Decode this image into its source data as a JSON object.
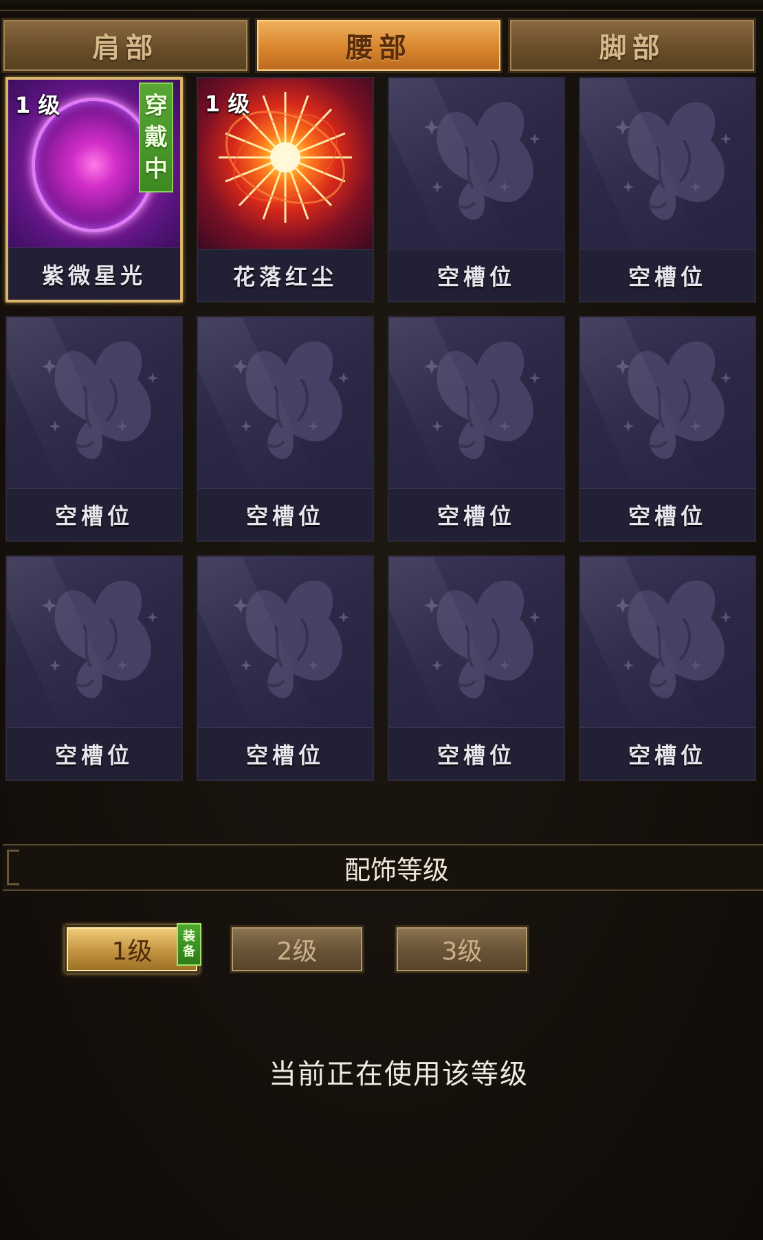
{
  "tabs": [
    {
      "label": "肩部",
      "active": false
    },
    {
      "label": "腰部",
      "active": true
    },
    {
      "label": "脚部",
      "active": false
    }
  ],
  "slots": [
    {
      "name": "紫微星光",
      "level": "1 级",
      "equipped_tag": [
        "穿",
        "戴",
        "中"
      ],
      "art": "purple-orb-icon",
      "selected": true
    },
    {
      "name": "花落红尘",
      "level": "1 级",
      "art": "red-starburst-icon"
    },
    {
      "name": "空槽位",
      "art": "butterfly-icon"
    },
    {
      "name": "空槽位",
      "art": "butterfly-icon"
    },
    {
      "name": "空槽位",
      "art": "butterfly-icon"
    },
    {
      "name": "空槽位",
      "art": "butterfly-icon"
    },
    {
      "name": "空槽位",
      "art": "butterfly-icon"
    },
    {
      "name": "空槽位",
      "art": "butterfly-icon"
    },
    {
      "name": "空槽位",
      "art": "butterfly-icon"
    },
    {
      "name": "空槽位",
      "art": "butterfly-icon"
    },
    {
      "name": "空槽位",
      "art": "butterfly-icon"
    },
    {
      "name": "空槽位",
      "art": "butterfly-icon"
    }
  ],
  "level_section": {
    "title": "配饰等级",
    "buttons": [
      {
        "label": "1级",
        "active": true,
        "badge": [
          "装",
          "备"
        ]
      },
      {
        "label": "2级",
        "active": false
      },
      {
        "label": "3级",
        "active": false
      }
    ],
    "status_text": "当前正在使用该等级"
  },
  "colors": {
    "active_tab": "#d9852e",
    "equipped_tag": "#3e8a22",
    "selected_border": "#d9b56e"
  }
}
